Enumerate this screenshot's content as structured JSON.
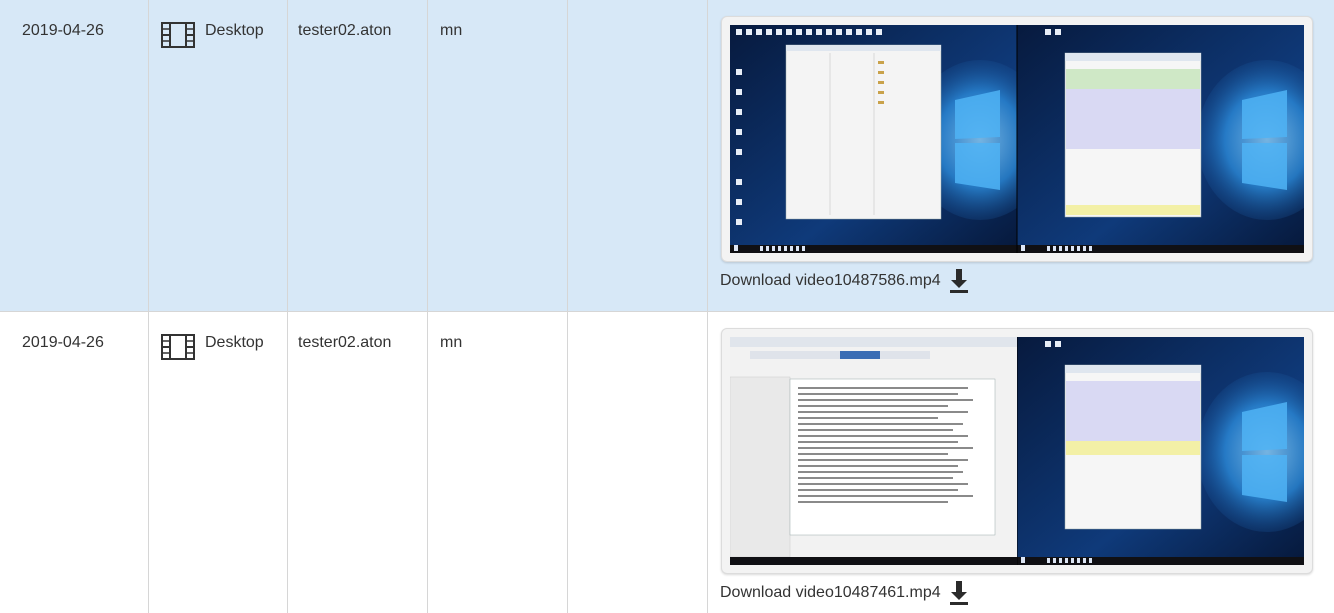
{
  "rows": [
    {
      "date": "2019-04-26",
      "type": "Desktop",
      "user": "tester02.aton",
      "short": "mn",
      "download_label": "Download video10487586.mp4",
      "selected": true
    },
    {
      "date": "2019-04-26",
      "type": "Desktop",
      "user": "tester02.aton",
      "short": "mn",
      "download_label": "Download video10487461.mp4",
      "selected": false
    }
  ],
  "colors": {
    "selected_row": "#d7e8f7",
    "grid": "#d6d6d6",
    "desktop_blue": "#0f2a5c"
  },
  "icons": {
    "type": "film-icon",
    "download": "download-arrow-icon"
  }
}
